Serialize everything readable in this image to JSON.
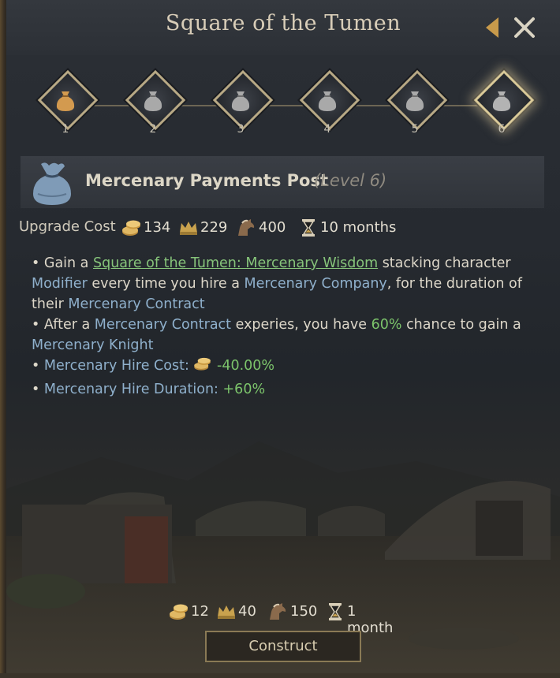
{
  "window": {
    "title": "Square of the Tumen"
  },
  "levels": [
    {
      "label": "1",
      "state": "completed"
    },
    {
      "label": "2",
      "state": "locked"
    },
    {
      "label": "3",
      "state": "locked"
    },
    {
      "label": "4",
      "state": "locked"
    },
    {
      "label": "5",
      "state": "locked"
    },
    {
      "label": "6",
      "state": "selected"
    }
  ],
  "building": {
    "name": "Mercenary Payments Post",
    "level": "(Level 6)",
    "icon": "money-bag-icon"
  },
  "upgrade_cost": {
    "label": "Upgrade Cost",
    "gold": "134",
    "prestige": "229",
    "horses": "400",
    "time": "10 months"
  },
  "effects": {
    "line1": {
      "prefix": "• Gain a ",
      "link": "Square of the Tumen: Mercenary Wisdom",
      "mid": " stacking character",
      "kw1": "Modifier",
      "mid2": " every time you hire a ",
      "kw2": "Mercenary Company",
      "mid3": ", for the duration of",
      "their": "their ",
      "kw3": "Mercenary Contract"
    },
    "line2": {
      "prefix": "• After a ",
      "kw1": "Mercenary Contract",
      "mid": " experies, you have ",
      "pct": "60%",
      "mid2": " chance to gain a",
      "kw2": "Mercenary Knight"
    },
    "line3": {
      "prefix": "• ",
      "label": "Mercenary Hire Cost: ",
      "value": "-40.00%"
    },
    "line4": {
      "prefix": "• ",
      "label": "Mercenary Hire Duration: ",
      "value": "+60%"
    }
  },
  "construct_cost": {
    "gold": "12",
    "prestige": "40",
    "horses": "150",
    "time": "1 month"
  },
  "construct_button": "Construct",
  "colors": {
    "accent_gold": "#d8cdb0",
    "keyword_blue": "#8fb0cc",
    "positive_green": "#7cc46b"
  }
}
